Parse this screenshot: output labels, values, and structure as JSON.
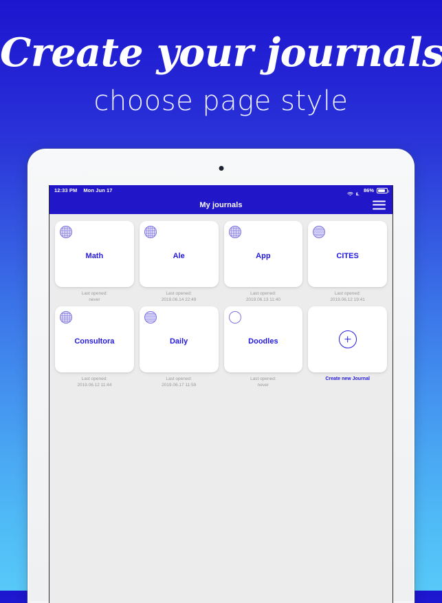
{
  "promo": {
    "title": "Create your journals",
    "subtitle": "choose page style"
  },
  "device": {
    "camera": "camera-dot"
  },
  "status_bar": {
    "time": "12:33 PM",
    "date": "Mon Jun 17",
    "wifi_icon": "wifi-icon",
    "moon_icon": "moon-icon",
    "battery_percent": "86%",
    "battery_icon": "battery-icon"
  },
  "nav": {
    "title": "My journals",
    "menu_icon": "hamburger-menu-icon"
  },
  "meta_label": "Last opened:",
  "journals": [
    {
      "title": "Math",
      "page_style": "grid",
      "last_opened": "never"
    },
    {
      "title": "Ale",
      "page_style": "grid",
      "last_opened": "2019.06.14 22:49"
    },
    {
      "title": "App",
      "page_style": "grid",
      "last_opened": "2019.06.13 11:40"
    },
    {
      "title": "CITES",
      "page_style": "lines",
      "last_opened": "2019.06.12 19:41"
    },
    {
      "title": "Consultora",
      "page_style": "grid",
      "last_opened": "2019.06.12 11:44"
    },
    {
      "title": "Daily",
      "page_style": "lines",
      "last_opened": "2019.06.17 11:59"
    },
    {
      "title": "Doodles",
      "page_style": "blank",
      "last_opened": "never"
    }
  ],
  "create_new": {
    "label": "Create new Journal",
    "icon": "plus-circle-icon"
  },
  "colors": {
    "brand_blue": "#2117c9",
    "accent_text": "#2117dd",
    "icon_stroke": "#7b72e0",
    "screen_bg": "#ececec",
    "card_bg": "#ffffff",
    "meta_text": "#9a9a9a",
    "gradient_top": "#1d16cf",
    "gradient_bottom": "#57c9f8"
  }
}
